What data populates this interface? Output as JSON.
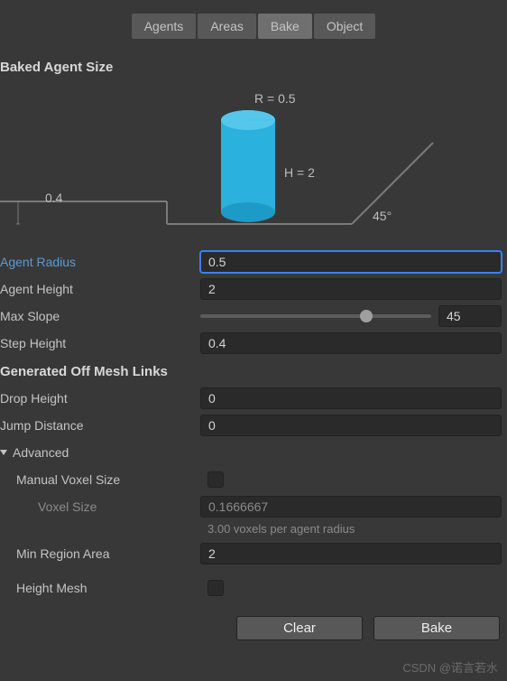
{
  "tabs": {
    "agents": "Agents",
    "areas": "Areas",
    "bake": "Bake",
    "object": "Object"
  },
  "section1": {
    "title": "Baked Agent Size"
  },
  "diagram": {
    "radius_label": "R = 0.5",
    "height_label": "H = 2",
    "step_label": "0.4",
    "slope_label": "45°"
  },
  "agent_radius": {
    "label": "Agent Radius",
    "value": "0.5"
  },
  "agent_height": {
    "label": "Agent Height",
    "value": "2"
  },
  "max_slope": {
    "label": "Max Slope",
    "value": "45",
    "percent": 72
  },
  "step_height": {
    "label": "Step Height",
    "value": "0.4"
  },
  "section2": {
    "title": "Generated Off Mesh Links"
  },
  "drop_height": {
    "label": "Drop Height",
    "value": "0"
  },
  "jump_distance": {
    "label": "Jump Distance",
    "value": "0"
  },
  "advanced": {
    "label": "Advanced"
  },
  "manual_voxel": {
    "label": "Manual Voxel Size",
    "checked": false
  },
  "voxel_size": {
    "label": "Voxel Size",
    "value": "0.1666667",
    "helper": "3.00 voxels per agent radius"
  },
  "min_region": {
    "label": "Min Region Area",
    "value": "2"
  },
  "height_mesh": {
    "label": "Height Mesh",
    "checked": false
  },
  "buttons": {
    "clear": "Clear",
    "bake": "Bake"
  },
  "watermark": "CSDN @诺言若水"
}
